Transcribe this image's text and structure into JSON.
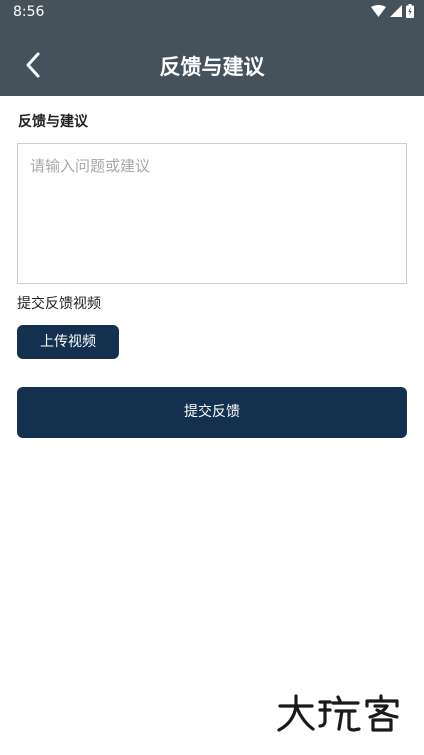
{
  "status_bar": {
    "time": "8:56",
    "icons": [
      "wifi-icon",
      "signal-icon",
      "battery-icon"
    ]
  },
  "header": {
    "title": "反馈与建议",
    "back_icon": "chevron-left-icon"
  },
  "form": {
    "section_label": "反馈与建议",
    "input_value": "",
    "input_placeholder": "请输入问题或建议",
    "video_label": "提交反馈视频",
    "upload_button_label": "上传视频",
    "submit_button_label": "提交反馈"
  },
  "watermark": {
    "text": "大玩客"
  },
  "colors": {
    "header_background": "#45525b",
    "primary_button": "#13314f",
    "input_border": "#cfcfcf",
    "placeholder_text": "#a8a8a8"
  }
}
